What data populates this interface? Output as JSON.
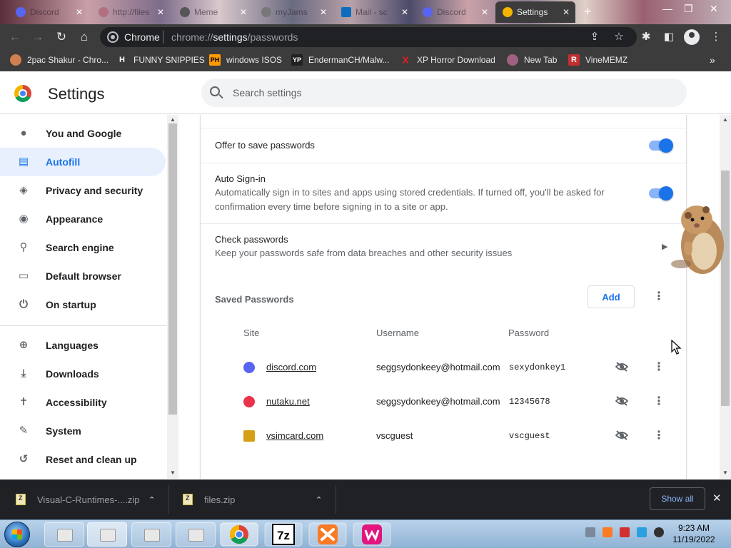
{
  "browser": {
    "tabs": [
      {
        "label": "Discord",
        "icon": "discord-icon",
        "color": "#5865f2"
      },
      {
        "label": "http://files",
        "icon": "globe-icon",
        "color": "#c9a0a8"
      },
      {
        "label": "Meme",
        "icon": "chrome-icon",
        "color": "#555555"
      },
      {
        "label": "myJams",
        "icon": "at-icon",
        "color": "#777777"
      },
      {
        "label": "Mail - sc",
        "icon": "outlook-icon",
        "color": "#0f6cbd"
      },
      {
        "label": "Discord",
        "icon": "discord-icon",
        "color": "#5865f2"
      },
      {
        "label": "Settings",
        "icon": "gear-icon",
        "color": "#f4b400"
      }
    ],
    "omnibox": {
      "origin": "Chrome",
      "url_prefix": "chrome://",
      "url_bold": "settings",
      "url_suffix": "/passwords"
    },
    "bookmarks": [
      {
        "label": "2pac Shakur - Chro...",
        "icon": "person-icon",
        "badge": "",
        "color": "#d08050"
      },
      {
        "label": "FUNNY SNIPPIES",
        "icon": "h-icon",
        "badge": "H",
        "color": "#ffffff"
      },
      {
        "label": "windows ISOS",
        "icon": "ph-icon",
        "badge": "PH",
        "color": "#ff9900"
      },
      {
        "label": "EndermanCH/Malw...",
        "icon": "yp-icon",
        "badge": "YP",
        "color": "#444444"
      },
      {
        "label": "XP Horror Download",
        "icon": "x-icon",
        "badge": "X",
        "color": "#e02020"
      },
      {
        "label": "New Tab",
        "icon": "newtab-icon",
        "badge": "",
        "color": "#a06080"
      },
      {
        "label": "VineMEMZ",
        "icon": "r-icon",
        "badge": "R",
        "color": "#c03030"
      }
    ],
    "more_bookmarks": "»"
  },
  "settings": {
    "title": "Settings",
    "search_placeholder": "Search settings",
    "nav": [
      {
        "label": "You and Google",
        "icon": "person-icon",
        "glyph": "👤",
        "active": false
      },
      {
        "label": "Autofill",
        "icon": "clipboard-icon",
        "glyph": "📋",
        "active": true
      },
      {
        "label": "Privacy and security",
        "icon": "shield-icon",
        "glyph": "⛉",
        "active": false
      },
      {
        "label": "Appearance",
        "icon": "palette-icon",
        "glyph": "🎨",
        "active": false
      },
      {
        "label": "Search engine",
        "icon": "search-icon",
        "glyph": "⚲",
        "active": false
      },
      {
        "label": "Default browser",
        "icon": "browser-icon",
        "glyph": "▭",
        "active": false
      },
      {
        "label": "On startup",
        "icon": "power-icon",
        "glyph": "⏻",
        "active": false
      },
      {
        "label": "Languages",
        "icon": "globe-icon",
        "glyph": "🌐",
        "active": false
      },
      {
        "label": "Downloads",
        "icon": "download-icon",
        "glyph": "⤓",
        "active": false
      },
      {
        "label": "Accessibility",
        "icon": "accessibility-icon",
        "glyph": "♿",
        "active": false
      },
      {
        "label": "System",
        "icon": "wrench-icon",
        "glyph": "🔧",
        "active": false
      },
      {
        "label": "Reset and clean up",
        "icon": "history-icon",
        "glyph": "↺",
        "active": false
      }
    ],
    "offer_to_save": {
      "label": "Offer to save passwords",
      "enabled": true
    },
    "auto_signin": {
      "label": "Auto Sign-in",
      "description": "Automatically sign in to sites and apps using stored credentials. If turned off, you'll be asked for confirmation every time before signing in to a site or app.",
      "enabled": true
    },
    "check_passwords": {
      "label": "Check passwords",
      "description": "Keep your passwords safe from data breaches and other security issues"
    },
    "saved_passwords": {
      "label": "Saved Passwords",
      "add_label": "Add",
      "columns": {
        "site": "Site",
        "username": "Username",
        "password": "Password"
      },
      "rows": [
        {
          "site": "discord.com",
          "icon": "discord-icon",
          "color": "#5865f2",
          "username": "seggsydonkeey@hotmail.com",
          "password": "sexydonkey1"
        },
        {
          "site": "nutaku.net",
          "icon": "nutaku-icon",
          "color": "#e8334a",
          "username": "seggsydonkeey@hotmail.com",
          "password": "12345678"
        },
        {
          "site": "vsimcard.com",
          "icon": "simcard-icon",
          "color": "#d4a017",
          "username": "vscguest",
          "password": "vscguest"
        }
      ]
    }
  },
  "downloads": {
    "items": [
      {
        "filename": "Visual-C-Runtimes-....zip",
        "icon": "zip-icon"
      },
      {
        "filename": "files.zip",
        "icon": "zip-icon"
      }
    ],
    "show_all_label": "Show all"
  },
  "taskbar": {
    "apps": [
      {
        "name": "explorer-window-1"
      },
      {
        "name": "explorer-window-2"
      },
      {
        "name": "explorer-window-3"
      },
      {
        "name": "explorer-window-4"
      },
      {
        "name": "chrome"
      },
      {
        "name": "7-zip"
      },
      {
        "name": "xampp"
      },
      {
        "name": "wamp"
      }
    ],
    "time": "9:23 AM",
    "date": "11/19/2022"
  }
}
